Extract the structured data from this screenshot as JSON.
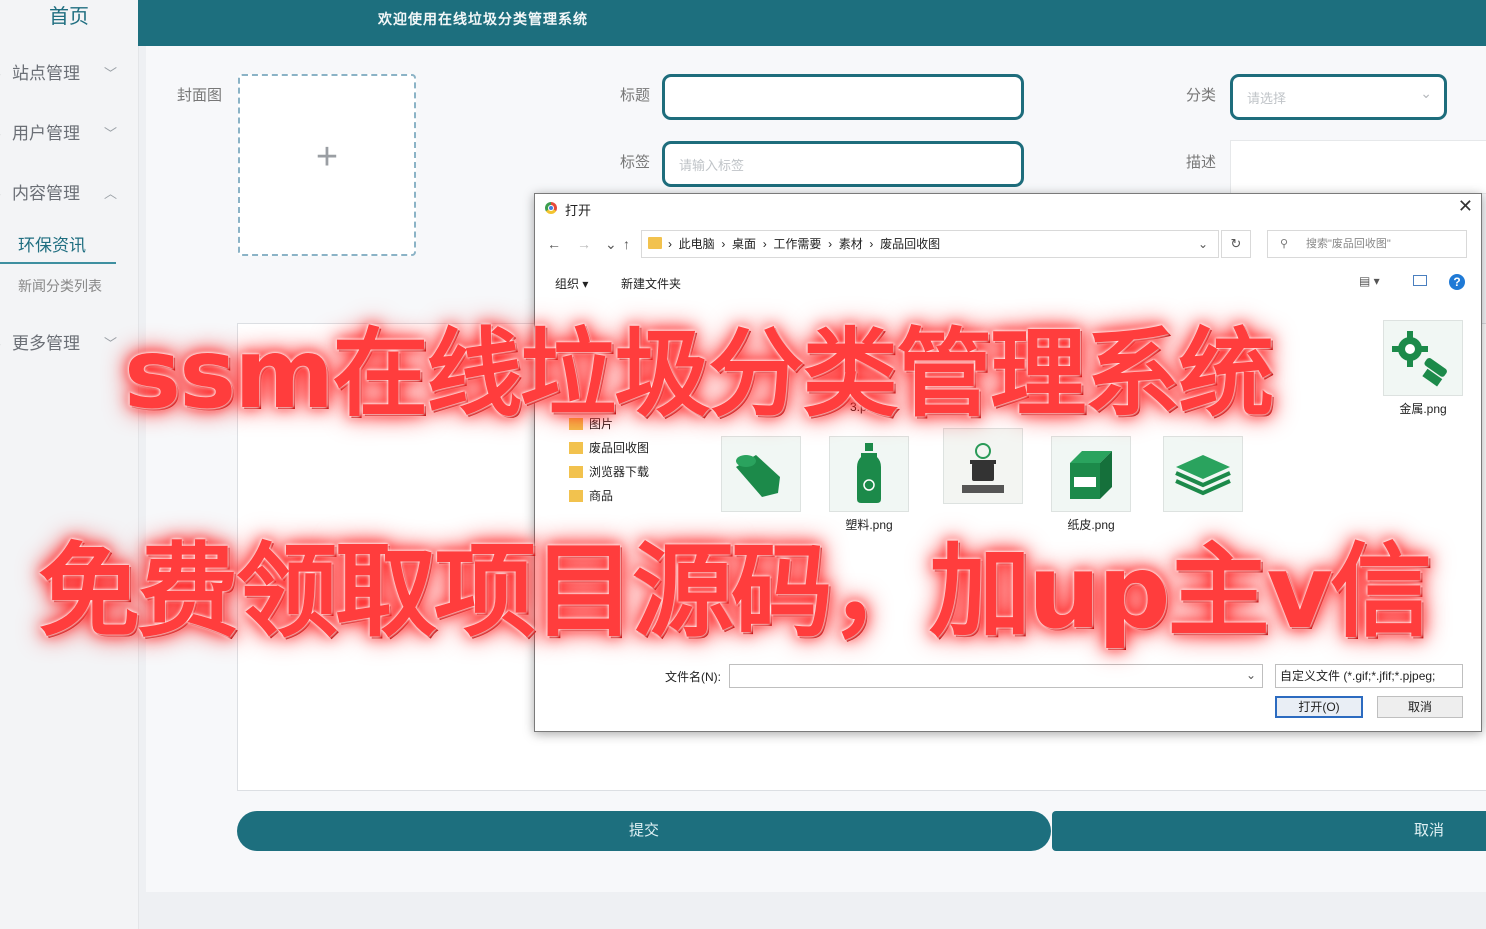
{
  "sidebar": {
    "home": "首页",
    "items": [
      {
        "label": "站点管理"
      },
      {
        "label": "用户管理"
      },
      {
        "label": "内容管理"
      },
      {
        "label": "更多管理"
      }
    ],
    "active_sub": "环保资讯",
    "sub2": "新闻分类列表"
  },
  "header": {
    "welcome": "欢迎使用在线垃圾分类管理系统"
  },
  "form": {
    "cover_label": "封面图",
    "title_label": "标题",
    "category_label": "分类",
    "category_placeholder": "请选择",
    "tags_label": "标签",
    "tags_placeholder": "请输入标签",
    "desc_label": "描述",
    "submit": "提交",
    "cancel": "取消"
  },
  "dialog": {
    "title": "打开",
    "breadcrumb": [
      "此电脑",
      "桌面",
      "工作需要",
      "素材",
      "废品回收图"
    ],
    "search_placeholder": "搜索\"废品回收图\"",
    "organize": "组织 ▾",
    "new_folder": "新建文件夹",
    "tree": [
      "图片",
      "废品回收图",
      "浏览器下载",
      "商品"
    ],
    "files_row1": [
      "3.png",
      "金属.png"
    ],
    "files_row2": [
      "塑料.png",
      "纸皮.png"
    ],
    "filename_label": "文件名(N):",
    "filetype": "自定义文件 (*.gif;*.jfif;*.pjpeg;",
    "open_button": "打开(O)",
    "cancel_button": "取消"
  },
  "overlay": {
    "line1": "ssm在线垃圾分类管理系统",
    "line2": "免费领取项目源码，加up主v信"
  },
  "colors": {
    "primary": "#1d6f7e",
    "overlay": "#ff3d3d"
  }
}
